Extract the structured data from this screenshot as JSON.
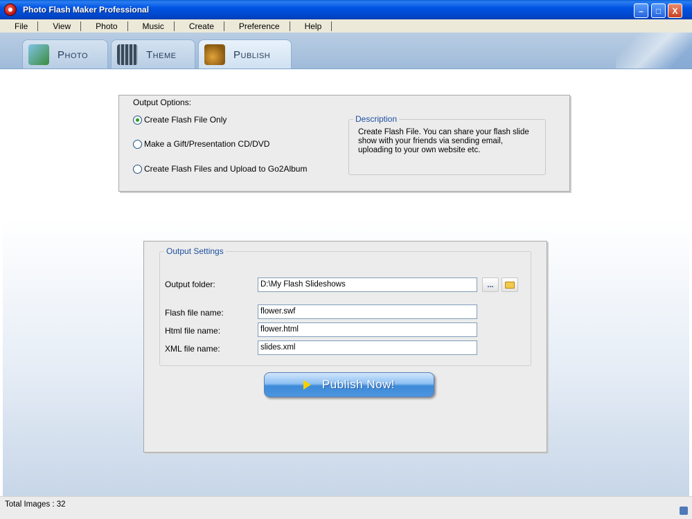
{
  "window": {
    "title": "Photo Flash Maker Professional",
    "minimize_glyph": "–",
    "maximize_glyph": "□",
    "close_glyph": "X"
  },
  "menu": {
    "items": [
      {
        "label": "File"
      },
      {
        "label": "View"
      },
      {
        "label": "Photo"
      },
      {
        "label": "Music"
      },
      {
        "label": "Create"
      },
      {
        "label": "Preference"
      },
      {
        "label": "Help"
      }
    ]
  },
  "tabs": [
    {
      "label": "Photo",
      "icon": "photo-icon",
      "active": false
    },
    {
      "label": "Theme",
      "icon": "film-icon",
      "active": false
    },
    {
      "label": "Publish",
      "icon": "publish-icon",
      "active": true
    }
  ],
  "output_options": {
    "title": "Output Options:",
    "options": [
      {
        "label": "Create Flash File Only",
        "selected": true
      },
      {
        "label": "Make a Gift/Presentation CD/DVD",
        "selected": false
      },
      {
        "label": "Create Flash Files and Upload to Go2Album",
        "selected": false
      }
    ],
    "description": {
      "legend": "Description",
      "text": "Create Flash File. You can share your flash slide show with your friends via sending email, uploading to your own website etc."
    }
  },
  "output_settings": {
    "legend": "Output Settings",
    "output_folder": {
      "label": "Output folder:",
      "value": "D:\\My Flash Slideshows",
      "browse_label": "..."
    },
    "flash_file": {
      "label": "Flash file name:",
      "value": "flower.swf"
    },
    "html_file": {
      "label": "Html file name:",
      "value": "flower.html"
    },
    "xml_file": {
      "label": "XML file name:",
      "value": "slides.xml"
    }
  },
  "publish_button": {
    "label": "Publish Now!"
  },
  "status": {
    "text": "Total Images : 32"
  },
  "colors": {
    "titlebar": "#0054e3",
    "legend_blue": "#1e4fa0",
    "publish_button": "#3e8ad9"
  }
}
